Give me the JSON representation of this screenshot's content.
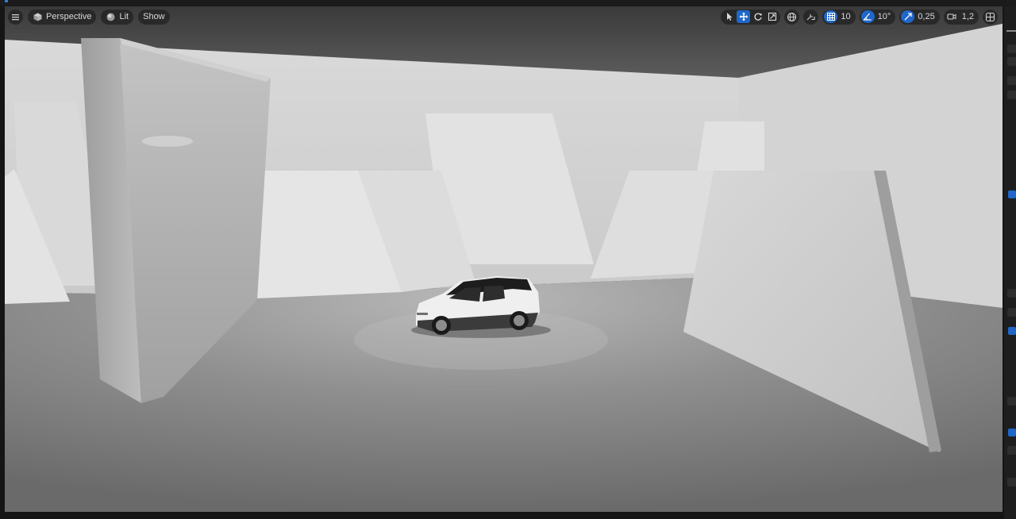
{
  "toolbar": {
    "menu_icon": "hamburger-menu-icon",
    "view_mode_label": "Perspective",
    "lighting_label": "Lit",
    "show_label": "Show",
    "grid_snap_value": "10",
    "rotation_snap_value": "10°",
    "scale_snap_value": "0,25",
    "camera_speed_value": "1,2"
  },
  "colors": {
    "accent": "#1f67c9",
    "toolbar_bg": "#262626",
    "panel_bg": "#1e1e1e"
  }
}
